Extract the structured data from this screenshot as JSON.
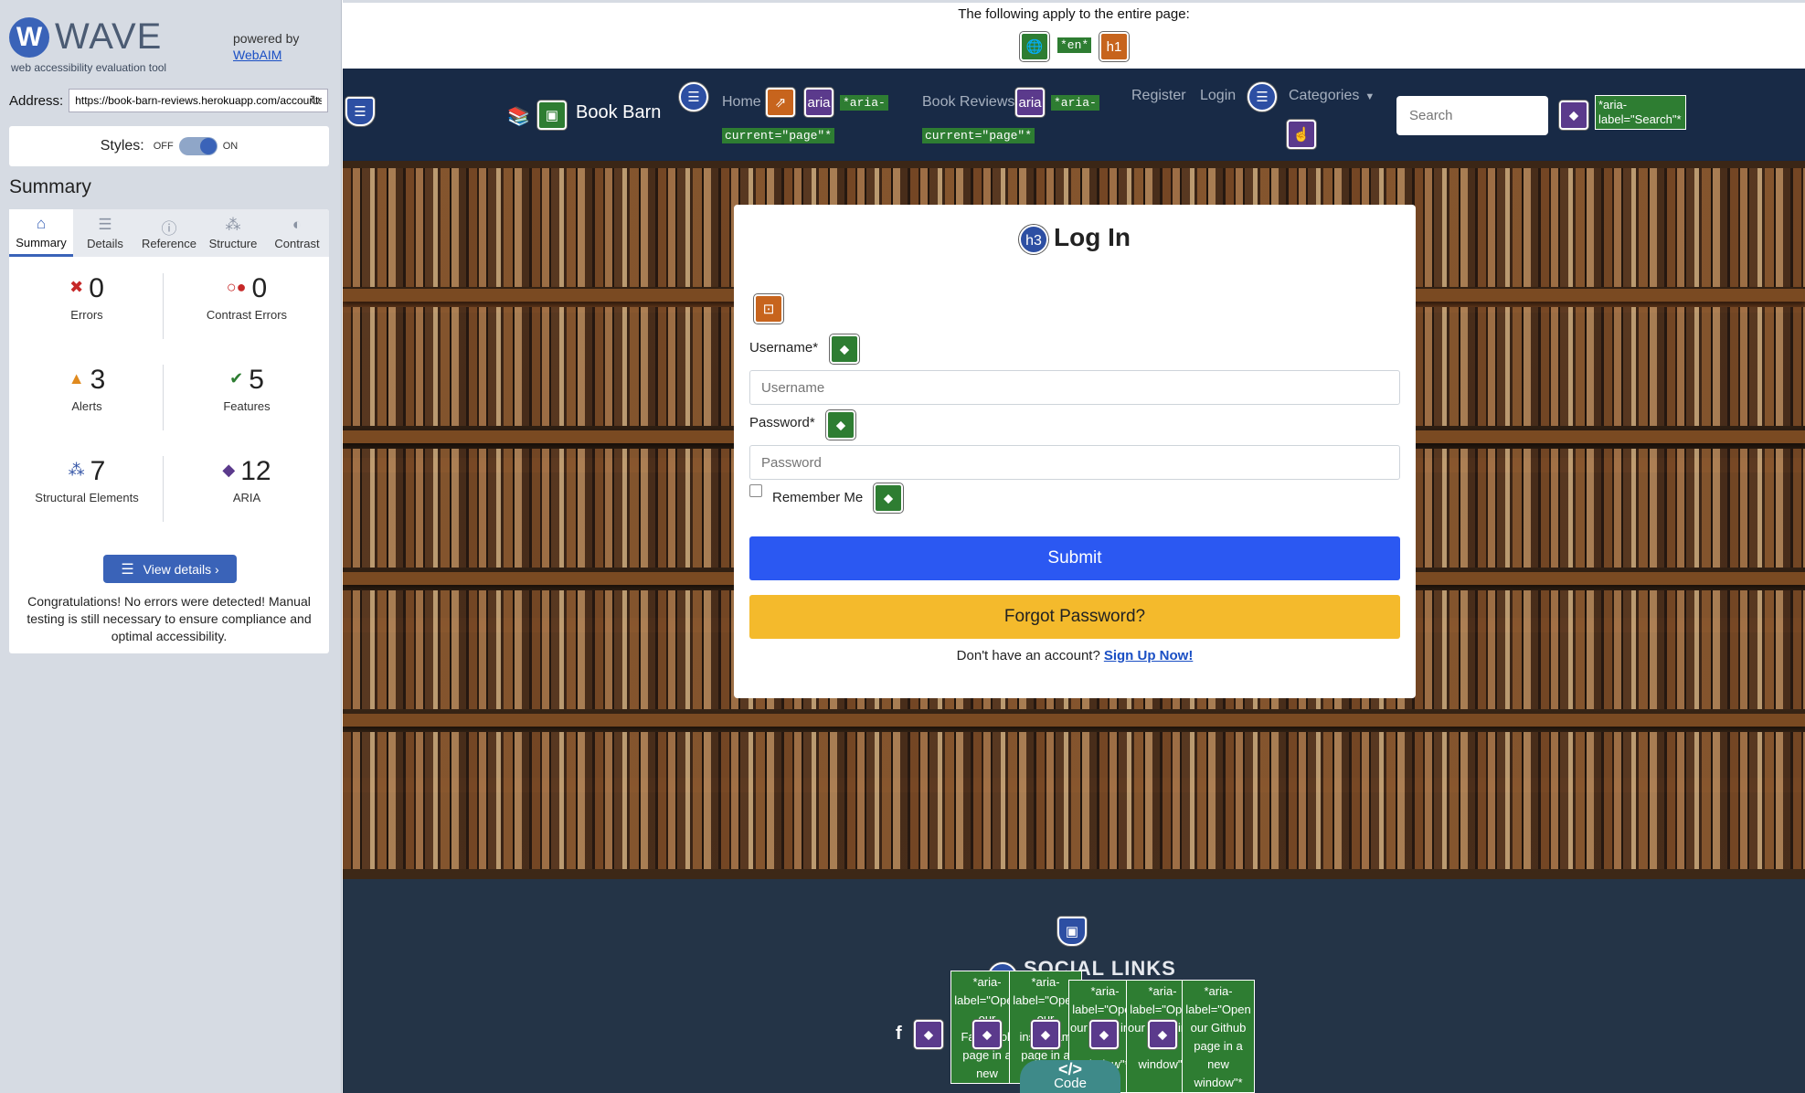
{
  "wave": {
    "title": "WAVE",
    "logo_letter": "W",
    "tagline": "web accessibility evaluation tool",
    "powered_by": "powered by",
    "webaim_link": "WebAIM",
    "address_label": "Address:",
    "address_value": "https://book-barn-reviews.herokuapp.com/accounts/login/",
    "styles_label": "Styles:",
    "styles_off": "OFF",
    "styles_on": "ON",
    "summary_heading": "Summary",
    "tabs": [
      {
        "label": "Summary",
        "icon": "home-icon"
      },
      {
        "label": "Details",
        "icon": "list-icon"
      },
      {
        "label": "Reference",
        "icon": "info-icon"
      },
      {
        "label": "Structure",
        "icon": "structure-icon"
      },
      {
        "label": "Contrast",
        "icon": "contrast-icon"
      }
    ],
    "stats": {
      "errors": {
        "count": "0",
        "label": "Errors"
      },
      "contrast": {
        "count": "0",
        "label": "Contrast Errors"
      },
      "alerts": {
        "count": "3",
        "label": "Alerts"
      },
      "features": {
        "count": "5",
        "label": "Features"
      },
      "structural": {
        "count": "7",
        "label": "Structural Elements"
      },
      "aria": {
        "count": "12",
        "label": "ARIA"
      }
    },
    "view_details": "View details ›",
    "congrats": "Congratulations! No errors were detected! Manual testing is still necessary to ensure compliance and optimal accessibility."
  },
  "page_banner": {
    "text": "The following apply to the entire page:",
    "lang_label": "*en*",
    "h1_label": "h1"
  },
  "navbar": {
    "brand": "Book Barn",
    "home": "Home",
    "aria": "aria",
    "aria_current_1": "*aria-",
    "aria_current_2": "current=\"page\"*",
    "book_reviews": "Book Reviews",
    "register": "Register",
    "login": "Login",
    "categories": "Categories",
    "search_placeholder": "Search",
    "search_aria_1": "*aria-",
    "search_aria_2": "label=\"Search\"*"
  },
  "login_card": {
    "h_badge": "h3",
    "title": "Log In",
    "username_label": "Username*",
    "username_placeholder": "Username",
    "password_label": "Password*",
    "password_placeholder": "Password",
    "remember_me": "Remember Me",
    "submit": "Submit",
    "forgot": "Forgot Password?",
    "no_account": "Don't have an account?",
    "signup_link": "Sign Up Now!"
  },
  "footer": {
    "h_badge": "h4",
    "social_title": "SOCIAL LINKS",
    "aria_cells": [
      "*aria-label=\"Open our Facebook page in a new window\"*",
      "*aria-label=\"Open our instagram page in a new window\"*",
      "*aria-label=\"Open our page in a new window\"*",
      "*aria-label=\"Open our page in a new window\"*",
      "*aria-label=\"Open our Github page in a new window\"*"
    ],
    "code_button": "Code",
    "code_symbol": "</>"
  },
  "colors": {
    "navbar_bg": "#182a46",
    "submit_blue": "#2b58f2",
    "forgot_yellow": "#f4ba2c",
    "wave_blue": "#3a63b8",
    "feature_green": "#2e7d32",
    "aria_purple": "#5b3a8c",
    "alert_orange": "#c7641d"
  }
}
